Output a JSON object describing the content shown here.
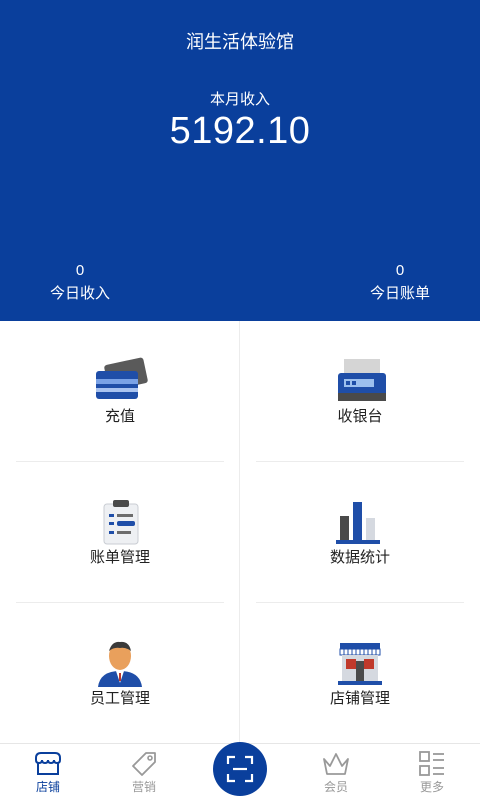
{
  "header": {
    "store_name": "润生活体验馆",
    "month_income_label": "本月收入",
    "month_income_value": "5192.10",
    "today_income_value": "0",
    "today_income_label": "今日收入",
    "today_bills_value": "0",
    "today_bills_label": "今日账单"
  },
  "menu": [
    {
      "label": "充值",
      "icon": "card-icon"
    },
    {
      "label": "收银台",
      "icon": "cash-register-icon"
    },
    {
      "label": "账单管理",
      "icon": "clipboard-icon"
    },
    {
      "label": "数据统计",
      "icon": "bar-chart-icon"
    },
    {
      "label": "员工管理",
      "icon": "staff-icon"
    },
    {
      "label": "店铺管理",
      "icon": "storefront-icon"
    }
  ],
  "nav": {
    "tabs": [
      {
        "label": "店铺",
        "icon": "shop-icon",
        "active": true
      },
      {
        "label": "营销",
        "icon": "tag-icon",
        "active": false
      },
      {
        "label": "会员",
        "icon": "crown-icon",
        "active": false
      },
      {
        "label": "更多",
        "icon": "more-grid-icon",
        "active": false
      }
    ],
    "scan_icon": "scan-icon"
  },
  "colors": {
    "brand": "#0a3f9c",
    "inactive": "#999999"
  }
}
